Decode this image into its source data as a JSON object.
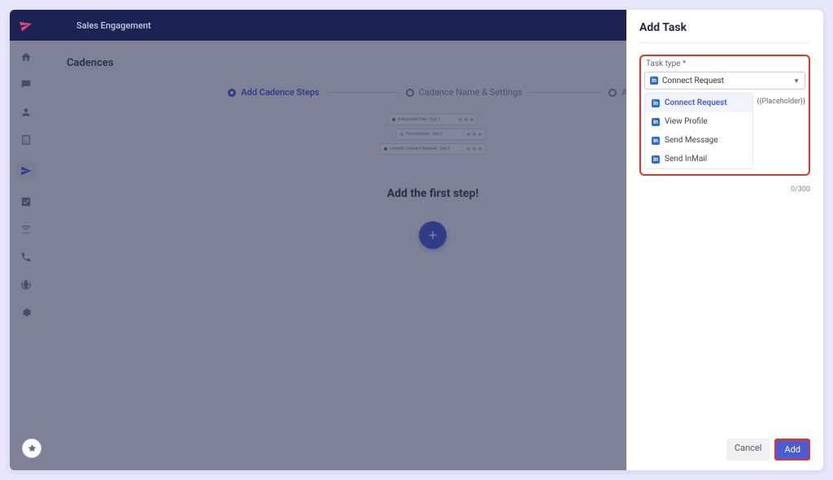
{
  "topbar": {
    "title": "Sales Engagement"
  },
  "page": {
    "title": "Cadences",
    "first_step_label": "Add the first step!"
  },
  "stepper": {
    "step1": "Add Cadence Steps",
    "step2": "Cadence Name & Settings",
    "step3": "Add"
  },
  "mini": {
    "r1": "Automated Step - Day 1",
    "r2": "Personalized - Day 2",
    "r3": "LinkedIn Connect Request - Day 3"
  },
  "panel": {
    "title": "Add Task",
    "task_type_label": "Task type *",
    "selected": "Connect Request",
    "options": {
      "connect": "Connect Request",
      "view": "View Profile",
      "send_msg": "Send Message",
      "send_inmail": "Send InMail"
    },
    "placeholder_tag": "{{Placeholder}}",
    "counter": "0/300",
    "cancel": "Cancel",
    "add": "Add"
  }
}
